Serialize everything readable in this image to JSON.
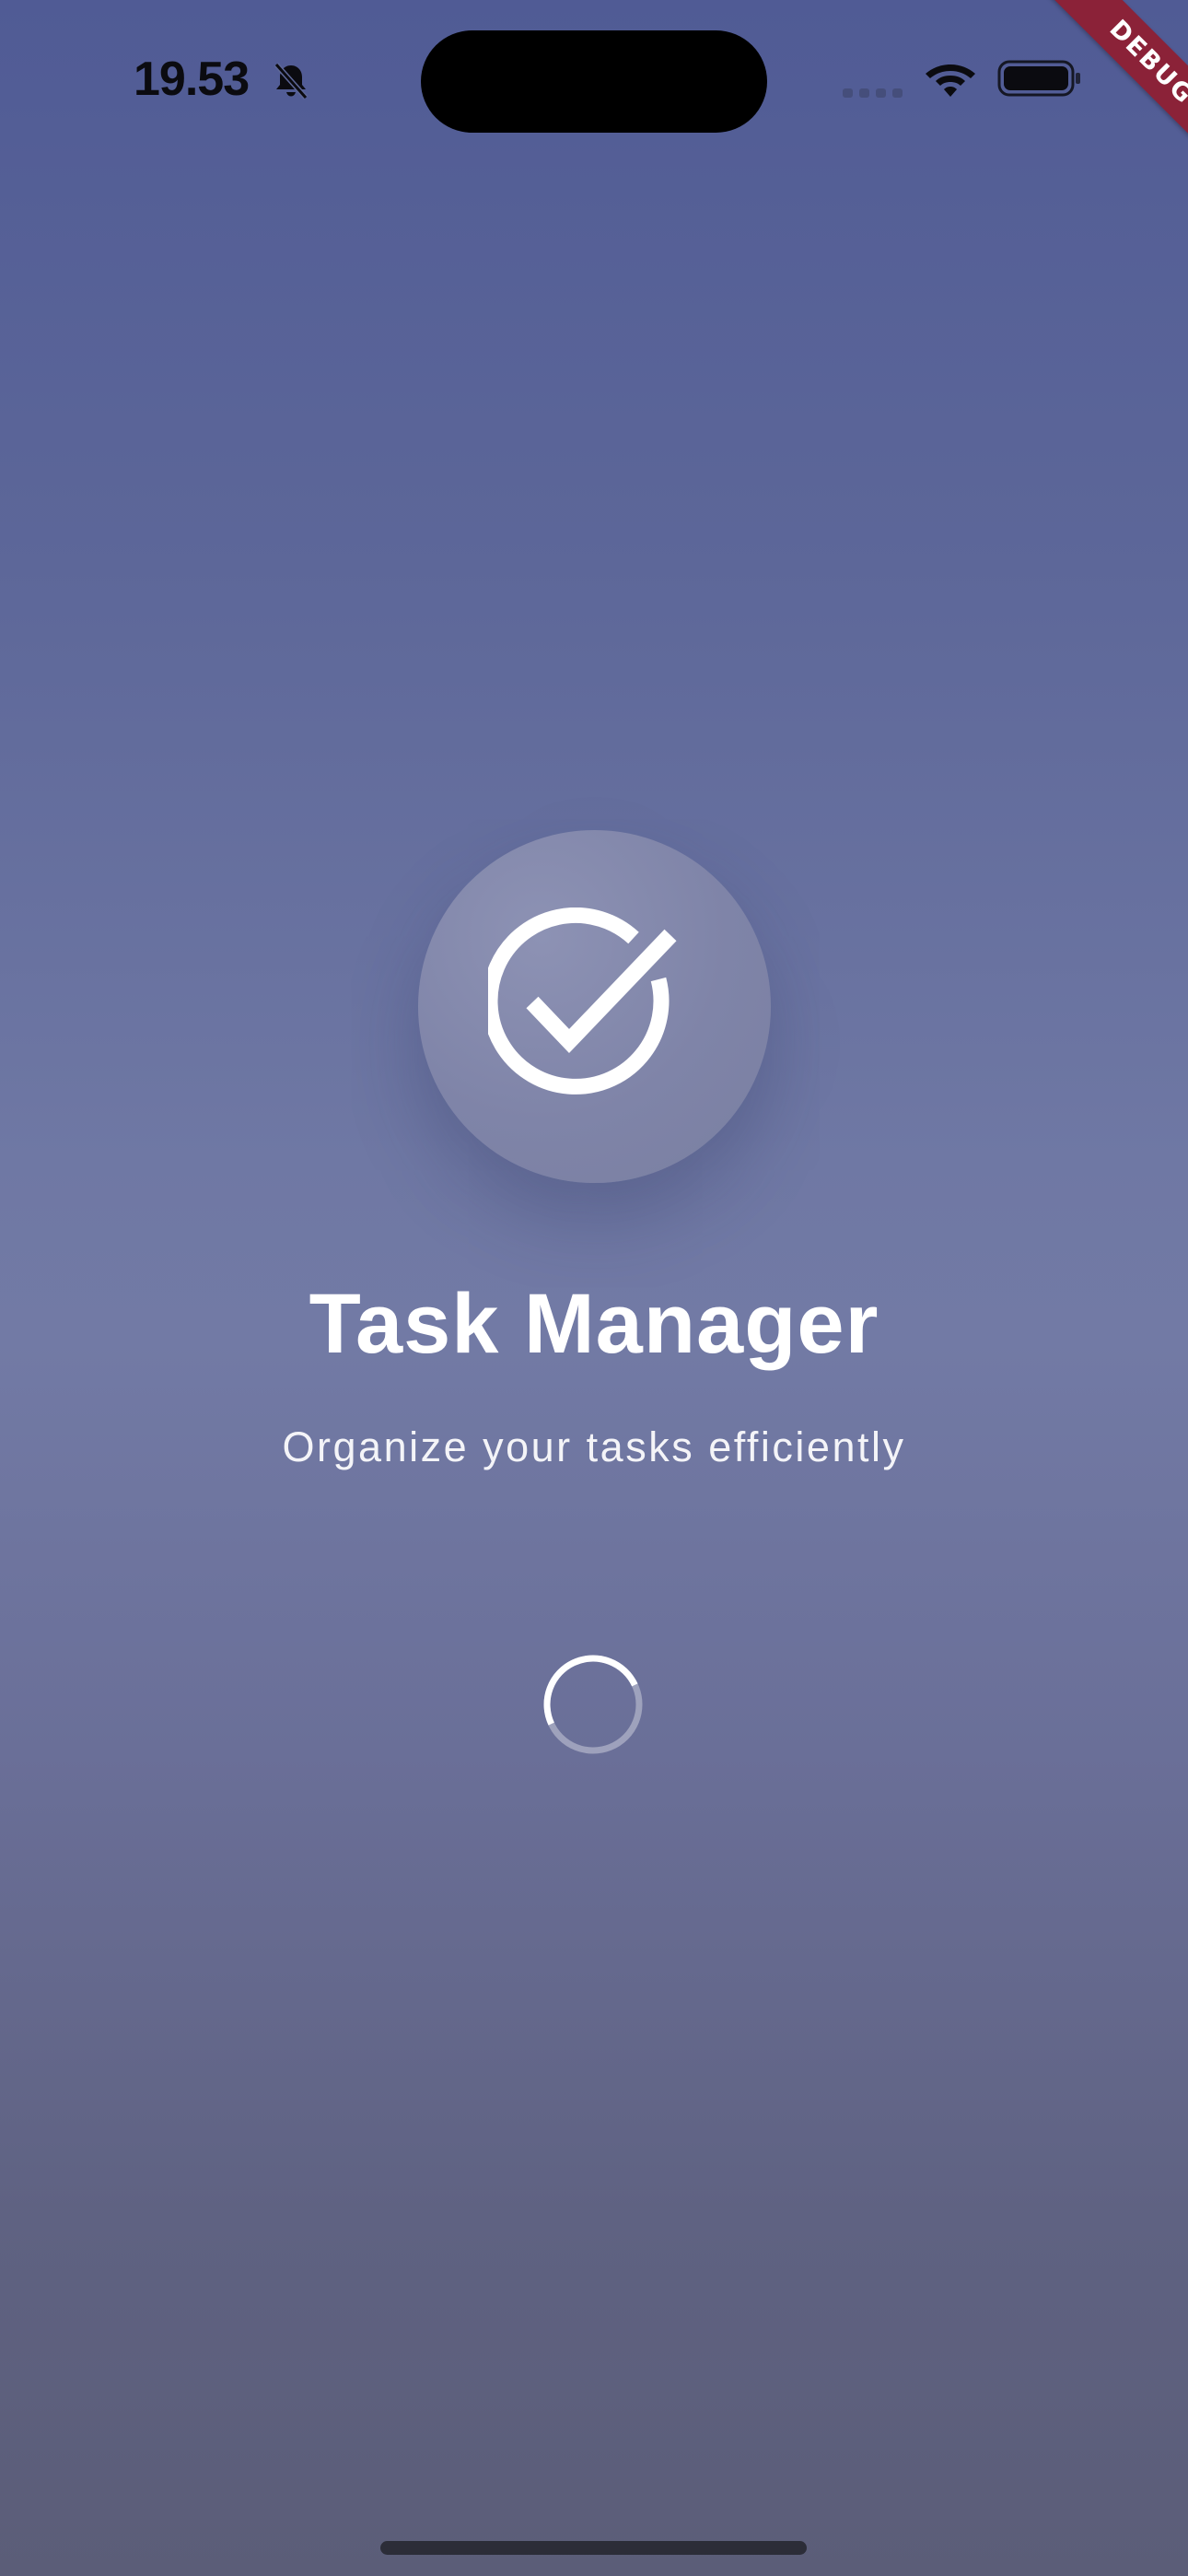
{
  "status_bar": {
    "time": "19.53",
    "icons": [
      "bell-slash-icon",
      "signal-dots-icon",
      "wifi-icon",
      "battery-icon"
    ]
  },
  "debug_banner": {
    "label": "DEBUG",
    "color": "#8b2238"
  },
  "splash": {
    "logo_icon": "check-circle-icon",
    "title": "Task Manager",
    "subtitle": "Organize your tasks efficiently",
    "loading_indicator": "loading-spinner"
  },
  "colors": {
    "background_top": "#505b95",
    "background_mid": "#727aa5",
    "background_bottom": "#5b5d78",
    "text": "#ffffff"
  }
}
